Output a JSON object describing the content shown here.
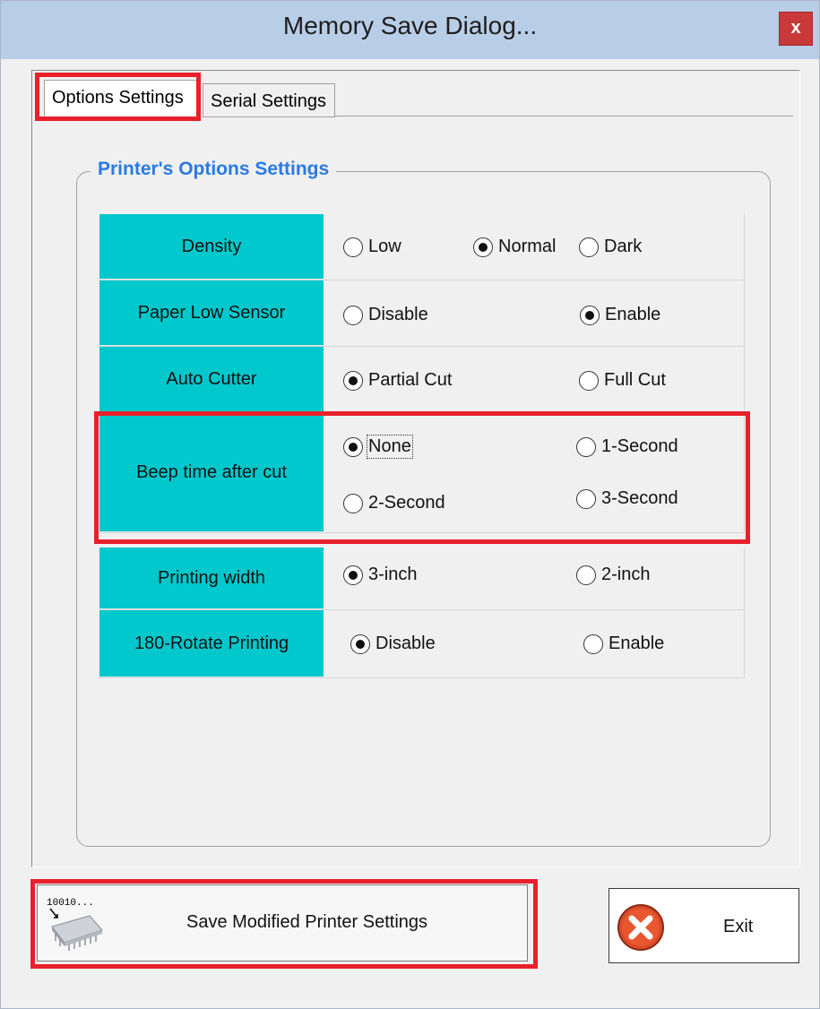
{
  "window": {
    "title": "Memory Save Dialog...",
    "close_label": "x"
  },
  "tabs": [
    {
      "label": "Options Settings",
      "selected": true
    },
    {
      "label": "Serial Settings",
      "selected": false
    }
  ],
  "group": {
    "title": "Printer's Options Settings"
  },
  "settings": [
    {
      "label": "Density",
      "options": [
        {
          "label": "Low",
          "checked": false
        },
        {
          "label": "Normal",
          "checked": true
        },
        {
          "label": "Dark",
          "checked": false
        }
      ]
    },
    {
      "label": "Paper Low Sensor",
      "options": [
        {
          "label": "Disable",
          "checked": false
        },
        {
          "label": "Enable",
          "checked": true
        }
      ]
    },
    {
      "label": "Auto Cutter",
      "options": [
        {
          "label": "Partial Cut",
          "checked": true
        },
        {
          "label": "Full Cut",
          "checked": false
        }
      ]
    },
    {
      "label": "Beep time after cut",
      "options": [
        {
          "label": "None",
          "checked": true
        },
        {
          "label": "1-Second",
          "checked": false
        },
        {
          "label": "2-Second",
          "checked": false
        },
        {
          "label": "3-Second",
          "checked": false
        }
      ]
    },
    {
      "label": "Printing width",
      "options": [
        {
          "label": "3-inch",
          "checked": true
        },
        {
          "label": "2-inch",
          "checked": false
        }
      ]
    },
    {
      "label": "180-Rotate Printing",
      "options": [
        {
          "label": "Disable",
          "checked": true
        },
        {
          "label": "Enable",
          "checked": false
        }
      ]
    }
  ],
  "buttons": {
    "save_label": "Save Modified Printer Settings",
    "save_icon_text": "10010...",
    "exit_label": "Exit"
  },
  "colors": {
    "label_bg": "#00c8cc",
    "group_title": "#2a7ae2",
    "highlight": "#e8202c",
    "titlebar": "#b8cde6"
  }
}
